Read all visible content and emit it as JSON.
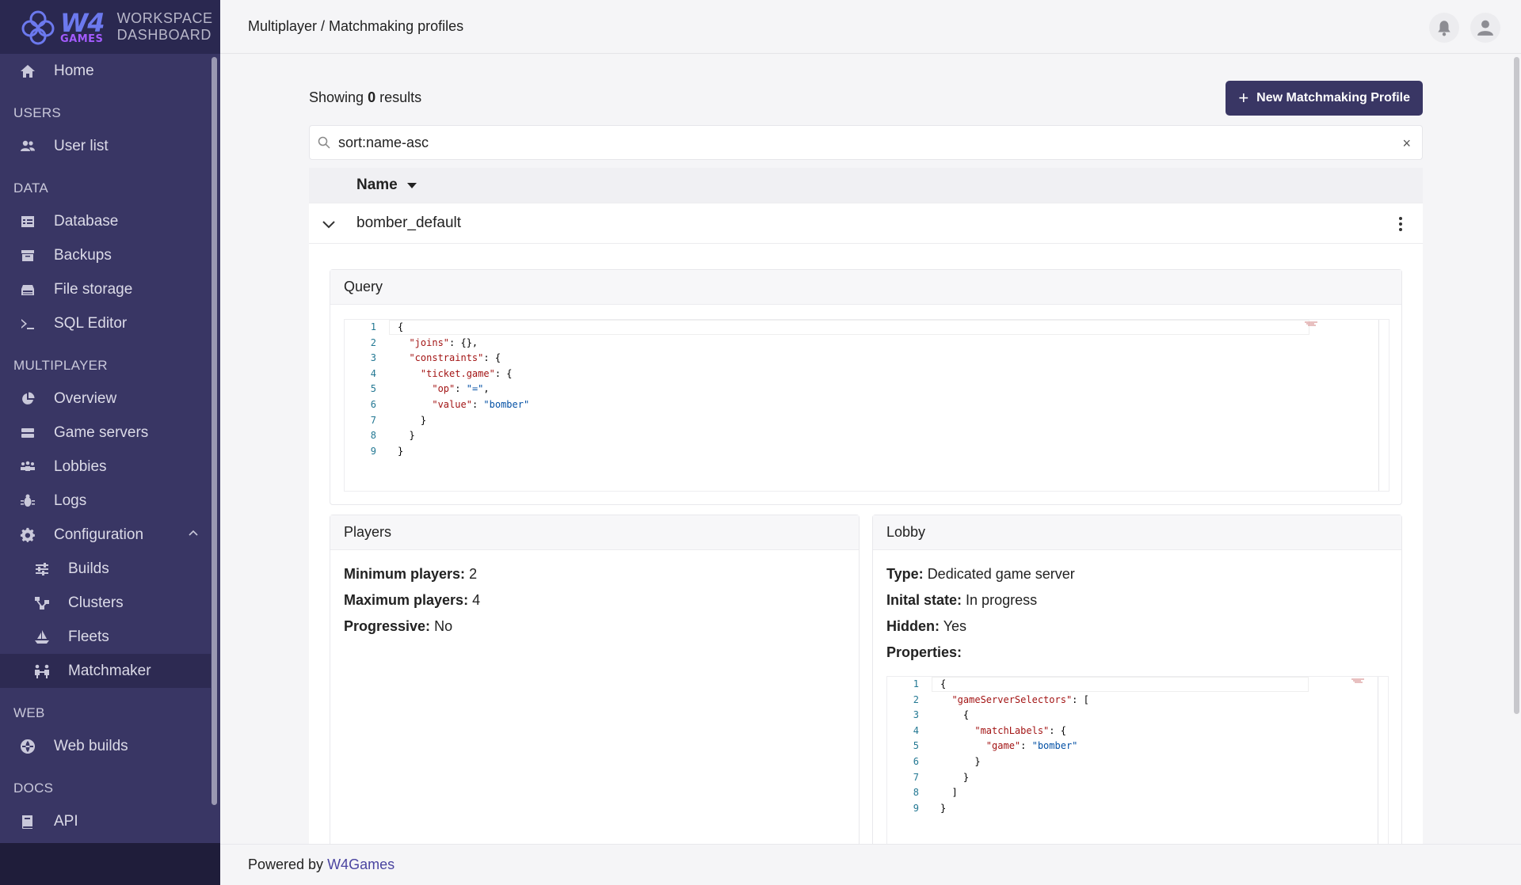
{
  "logo": {
    "brand": "W4",
    "brand_sub": "GAMES",
    "title_line1": "WORKSPACE",
    "title_line2": "DASHBOARD"
  },
  "sidebar": {
    "home": "Home",
    "users_section": "USERS",
    "user_list": "User list",
    "data_section": "DATA",
    "database": "Database",
    "backups": "Backups",
    "file_storage": "File storage",
    "sql_editor": "SQL Editor",
    "multiplayer_section": "MULTIPLAYER",
    "overview": "Overview",
    "game_servers": "Game servers",
    "lobbies": "Lobbies",
    "logs": "Logs",
    "configuration": "Configuration",
    "builds": "Builds",
    "clusters": "Clusters",
    "fleets": "Fleets",
    "matchmaker": "Matchmaker",
    "web_section": "WEB",
    "web_builds": "Web builds",
    "docs_section": "DOCS",
    "api": "API"
  },
  "header": {
    "breadcrumb": "Multiplayer / Matchmaking profiles"
  },
  "main": {
    "showing_prefix": "Showing",
    "showing_count": "0",
    "showing_suffix": "results",
    "new_button": "New Matchmaking Profile",
    "search_value": "sort:name-asc",
    "clear_glyph": "×",
    "column_name": "Name",
    "row_name": "bomber_default"
  },
  "query_card": {
    "title": "Query",
    "lines": [
      "1",
      "2",
      "3",
      "4",
      "5",
      "6",
      "7",
      "8",
      "9"
    ]
  },
  "players_card": {
    "title": "Players",
    "min_label": "Minimum players:",
    "min_value": "2",
    "max_label": "Maximum players:",
    "max_value": "4",
    "prog_label": "Progressive:",
    "prog_value": "No"
  },
  "lobby_card": {
    "title": "Lobby",
    "type_label": "Type:",
    "type_value": "Dedicated game server",
    "state_label": "Inital state:",
    "state_value": "In progress",
    "hidden_label": "Hidden:",
    "hidden_value": "Yes",
    "props_label": "Properties:"
  },
  "footer": {
    "prefix": "Powered by",
    "link": "W4Games"
  },
  "colors": {
    "sidebar_bg": "#393664",
    "accent": "#393664",
    "link": "#4a44a0"
  }
}
